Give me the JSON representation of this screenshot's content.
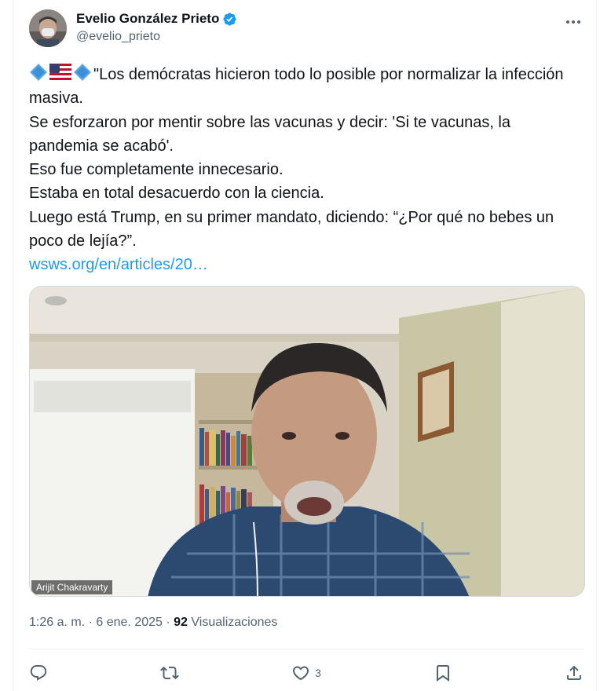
{
  "author": {
    "display_name": "Evelio González Prieto",
    "handle": "@evelio_prieto"
  },
  "tweet": {
    "lines": [
      "\"Los demócratas hicieron todo lo posible por normalizar la infección masiva.",
      "Se esforzaron por mentir sobre las vacunas y decir: 'Si te vacunas, la pandemia se acabó'.",
      "Eso fue completamente innecesario.",
      "Estaba en total desacuerdo con la ciencia.",
      "Luego está Trump, en su primer mandato, diciendo: “¿Por qué no bebes un poco de lejía?”."
    ],
    "link": "wsws.org/en/articles/20…",
    "leading_emojis": [
      "blue-diamond",
      "us-flag",
      "blue-diamond"
    ]
  },
  "media": {
    "caption": "Arijit Chakravarty"
  },
  "meta": {
    "time": "1:26 a. m.",
    "separator": "·",
    "date": "6 ene. 2025",
    "views_count": "92",
    "views_label": "Visualizaciones"
  },
  "actions": {
    "reply": "",
    "retweet": "",
    "like": "3",
    "bookmark": "",
    "share": ""
  },
  "colors": {
    "accent": "#1d9bf0",
    "text": "#0f1419",
    "muted": "#536471"
  }
}
